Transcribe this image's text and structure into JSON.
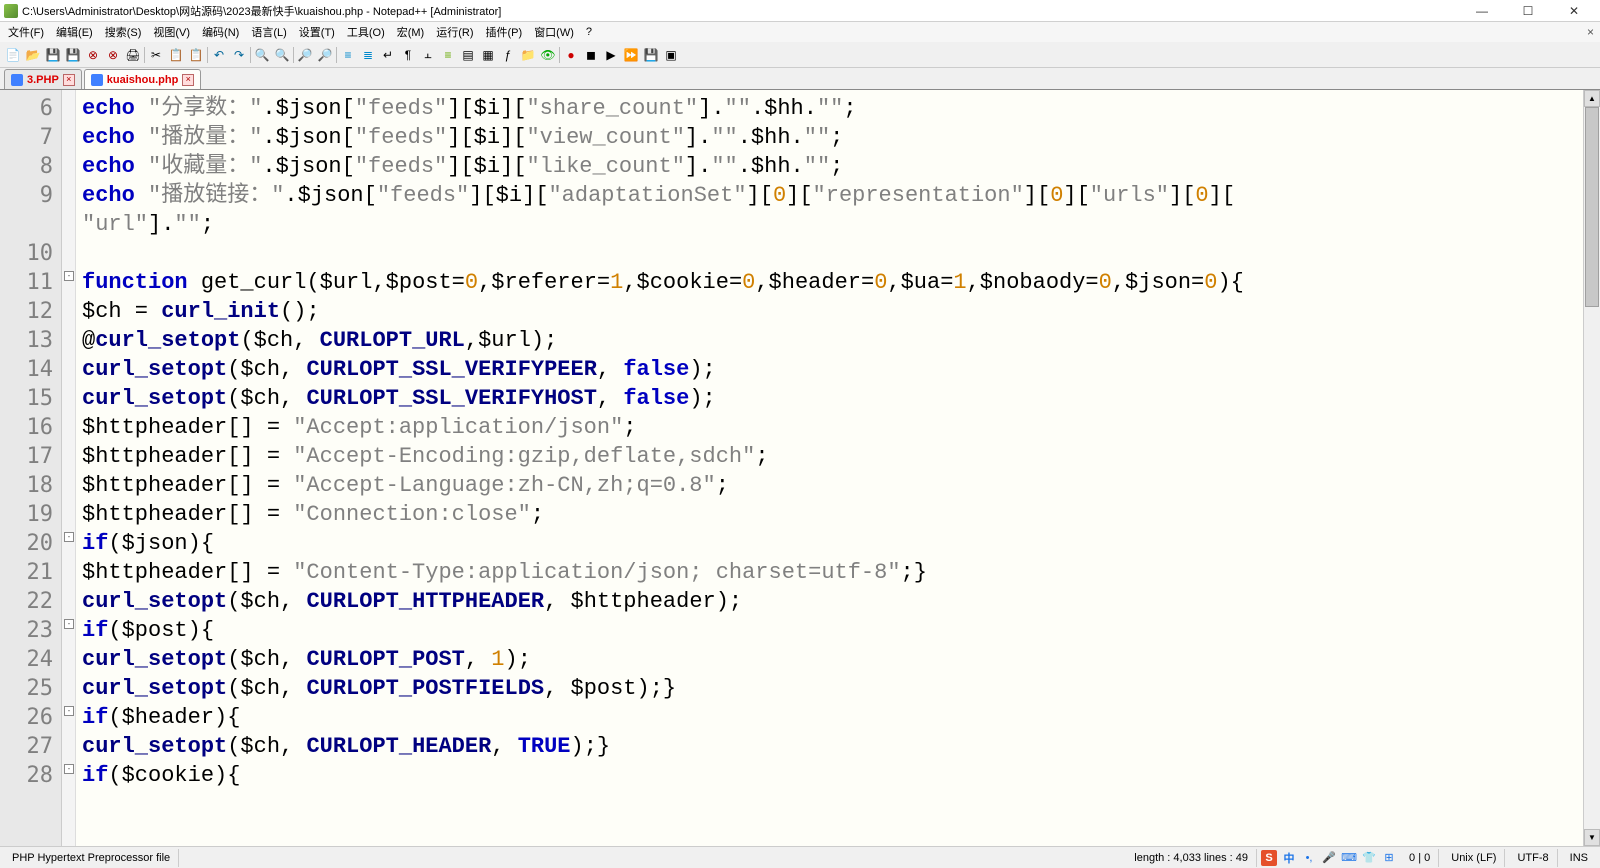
{
  "window": {
    "title": "C:\\Users\\Administrator\\Desktop\\网站源码\\2023最新快手\\kuaishou.php - Notepad++ [Administrator]"
  },
  "menu": {
    "file": "文件(F)",
    "edit": "编辑(E)",
    "search": "搜索(S)",
    "view": "视图(V)",
    "encoding": "编码(N)",
    "language": "语言(L)",
    "settings": "设置(T)",
    "tools": "工具(O)",
    "macro": "宏(M)",
    "run": "运行(R)",
    "plugins": "插件(P)",
    "window": "窗口(W)",
    "help": "?"
  },
  "tabs": {
    "tab1": "3.PHP",
    "tab2": "kuaishou.php"
  },
  "code": {
    "line6": {
      "num": "6",
      "p1": "echo",
      "p2": "\"分享数：\"",
      "p3": ".$json[",
      "p4": "\"feeds\"",
      "p5": "][$i][",
      "p6": "\"share_count\"",
      "p7": "].",
      "p8": "\"\"",
      "p9": ".$hh.",
      "p10": "\"\"",
      "p11": ";"
    },
    "line7": {
      "num": "7",
      "p1": "echo",
      "p2": "\"播放量：\"",
      "p3": ".$json[",
      "p4": "\"feeds\"",
      "p5": "][$i][",
      "p6": "\"view_count\"",
      "p7": "].",
      "p8": "\"\"",
      "p9": ".$hh.",
      "p10": "\"\"",
      "p11": ";"
    },
    "line8": {
      "num": "8",
      "p1": "echo",
      "p2": "\"收藏量：\"",
      "p3": ".$json[",
      "p4": "\"feeds\"",
      "p5": "][$i][",
      "p6": "\"like_count\"",
      "p7": "].",
      "p8": "\"\"",
      "p9": ".$hh.",
      "p10": "\"\"",
      "p11": ";"
    },
    "line9": {
      "num": "9",
      "p1": "echo",
      "p2": "\"播放链接：\"",
      "p3": ".$json[",
      "p4": "\"feeds\"",
      "p5": "][$i][",
      "p6": "\"adaptationSet\"",
      "p7": "][",
      "p8": "0",
      "p9": "][",
      "p10": "\"representation\"",
      "p11": "][",
      "p12": "0",
      "p13": "][",
      "p14": "\"urls\"",
      "p15": "][",
      "p16": "0",
      "p17": "]["
    },
    "line9b": {
      "p1": "\"url\"",
      "p2": "].",
      "p3": "\"\"",
      "p4": ";"
    },
    "line10": {
      "num": "10"
    },
    "line11": {
      "num": "11",
      "p1": "function",
      "p2": " get_curl",
      "p3": "($url,$post=",
      "p4": "0",
      "p5": ",$referer=",
      "p6": "1",
      "p7": ",$cookie=",
      "p8": "0",
      "p9": ",$header=",
      "p10": "0",
      "p11": ",$ua=",
      "p12": "1",
      "p13": ",$nobaody=",
      "p14": "0",
      "p15": ",$json=",
      "p16": "0",
      "p17": "){"
    },
    "line12": {
      "num": "12",
      "p1": "$ch = ",
      "p2": "curl_init",
      "p3": "();"
    },
    "line13": {
      "num": "13",
      "p1": "@",
      "p2": "curl_setopt",
      "p3": "($ch, ",
      "p4": "CURLOPT_URL",
      "p5": ",$url);"
    },
    "line14": {
      "num": "14",
      "p1": "curl_setopt",
      "p2": "($ch, ",
      "p3": "CURLOPT_SSL_VERIFYPEER",
      "p4": ", ",
      "p5": "false",
      "p6": ");"
    },
    "line15": {
      "num": "15",
      "p1": "curl_setopt",
      "p2": "($ch, ",
      "p3": "CURLOPT_SSL_VERIFYHOST",
      "p4": ", ",
      "p5": "false",
      "p6": ");"
    },
    "line16": {
      "num": "16",
      "p1": "$httpheader[] = ",
      "p2": "\"Accept:application/json\"",
      "p3": ";"
    },
    "line17": {
      "num": "17",
      "p1": "$httpheader[] = ",
      "p2": "\"Accept-Encoding:gzip,deflate,sdch\"",
      "p3": ";"
    },
    "line18": {
      "num": "18",
      "p1": "$httpheader[] = ",
      "p2": "\"Accept-Language:zh-CN,zh;q=0.8\"",
      "p3": ";"
    },
    "line19": {
      "num": "19",
      "p1": "$httpheader[] = ",
      "p2": "\"Connection:close\"",
      "p3": ";"
    },
    "line20": {
      "num": "20",
      "p1": "if",
      "p2": "($json){"
    },
    "line21": {
      "num": "21",
      "p1": "$httpheader[] = ",
      "p2": "\"Content-Type:application/json; charset=utf-8\"",
      "p3": ";}"
    },
    "line22": {
      "num": "22",
      "p1": "curl_setopt",
      "p2": "($ch, ",
      "p3": "CURLOPT_HTTPHEADER",
      "p4": ", $httpheader);"
    },
    "line23": {
      "num": "23",
      "p1": "if",
      "p2": "($post){"
    },
    "line24": {
      "num": "24",
      "p1": "curl_setopt",
      "p2": "($ch, ",
      "p3": "CURLOPT_POST",
      "p4": ", ",
      "p5": "1",
      "p6": ");"
    },
    "line25": {
      "num": "25",
      "p1": "curl_setopt",
      "p2": "($ch, ",
      "p3": "CURLOPT_POSTFIELDS",
      "p4": ", $post);}"
    },
    "line26": {
      "num": "26",
      "p1": "if",
      "p2": "($header){"
    },
    "line27": {
      "num": "27",
      "p1": "curl_setopt",
      "p2": "($ch, ",
      "p3": "CURLOPT_HEADER",
      "p4": ", ",
      "p5": "TRUE",
      "p6": ");}"
    },
    "line28": {
      "num": "28",
      "p1": "if",
      "p2": "($cookie){"
    }
  },
  "status": {
    "filetype": "PHP Hypertext Preprocessor file",
    "length": "length : 4,033    lines : 49",
    "pos": "0 | 0",
    "eol": "Unix (LF)",
    "enc": "UTF-8",
    "ins": "INS"
  },
  "ime": {
    "cn": "中"
  }
}
